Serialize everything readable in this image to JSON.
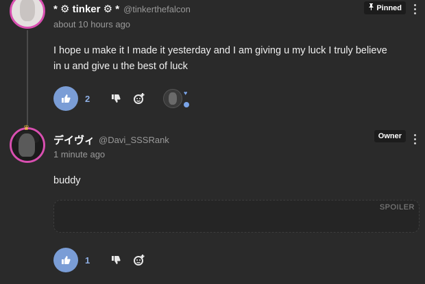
{
  "comments": [
    {
      "username": "* ⚙ tinker ⚙ *",
      "handle": "@tinkerthefalcon",
      "time": "about 10 hours ago",
      "badge": "Pinned",
      "badge_icon": "pin-icon",
      "text": "I hope u make it I made it yesterday and I am giving u my luck I truly believe in u and give u the best of luck",
      "like_count": "2"
    },
    {
      "username": "デイヴィ",
      "handle": "@Davi_SSSRank",
      "time": "1 minute ago",
      "badge": "Owner",
      "text": "buddy",
      "spoiler_label": "SPOILER",
      "like_count": "1"
    }
  ],
  "colors": {
    "background": "#2a2a2a",
    "accent": "#7a9dd6",
    "avatar_ring": "#d84fb0",
    "muted": "#9a9a9a"
  }
}
